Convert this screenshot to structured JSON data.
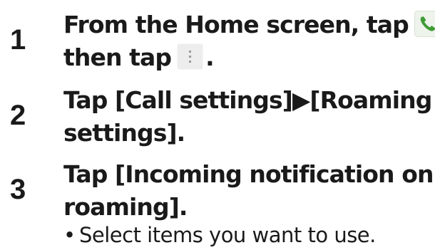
{
  "steps": [
    {
      "number": "1",
      "line1_before": "From the Home screen, tap",
      "line1_after": ",",
      "line2_before": "then tap",
      "line2_after": ".",
      "icons": [
        "phone-icon",
        "menu-icon"
      ]
    },
    {
      "number": "2",
      "line1": "Tap [Call settings]▶[Roaming",
      "line2": "settings]."
    },
    {
      "number": "3",
      "line1": "Tap [Incoming notification on",
      "line2": "roaming].",
      "note_bullet": "•",
      "note": "Select items you want to use."
    }
  ],
  "colors": {
    "text": "#1a1a1a",
    "phone_icon_bg": "#eef3ec",
    "phone_icon_fg": "#3f9c35",
    "menu_icon_bg": "#ededed",
    "menu_icon_dots": "#9a9a9a"
  }
}
